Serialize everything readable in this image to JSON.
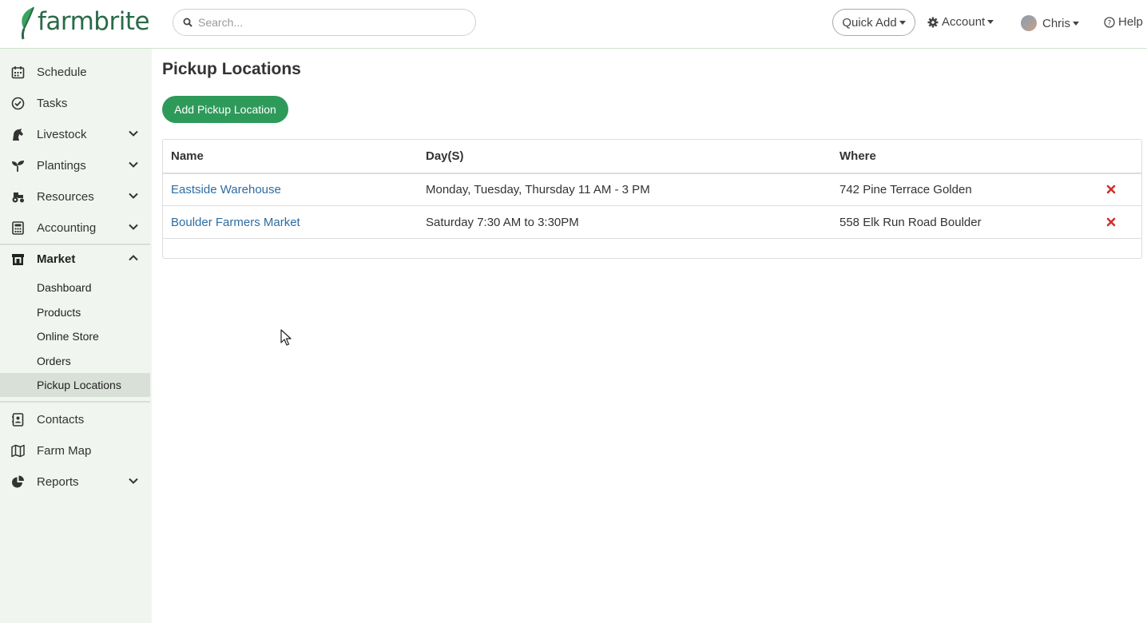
{
  "brand": {
    "name": "farmbrite",
    "color": "#2a6a48"
  },
  "search": {
    "placeholder": "Search..."
  },
  "header": {
    "quick_add": "Quick Add",
    "account": "Account",
    "user": "Chris",
    "help": "Help"
  },
  "sidebar": {
    "items": [
      {
        "label": "Schedule",
        "icon": "calendar-icon"
      },
      {
        "label": "Tasks",
        "icon": "check-circle-icon"
      },
      {
        "label": "Livestock",
        "icon": "horse-icon"
      },
      {
        "label": "Plantings",
        "icon": "seedling-icon"
      },
      {
        "label": "Resources",
        "icon": "tractor-icon"
      },
      {
        "label": "Accounting",
        "icon": "calculator-icon"
      },
      {
        "label": "Market",
        "icon": "store-icon"
      },
      {
        "label": "Contacts",
        "icon": "address-book-icon"
      },
      {
        "label": "Farm Map",
        "icon": "map-icon"
      },
      {
        "label": "Reports",
        "icon": "pie-chart-icon"
      }
    ],
    "market_sub": [
      {
        "label": "Dashboard"
      },
      {
        "label": "Products"
      },
      {
        "label": "Online Store"
      },
      {
        "label": "Orders"
      },
      {
        "label": "Pickup Locations",
        "active": true
      }
    ]
  },
  "main": {
    "title": "Pickup Locations",
    "add_button": "Add Pickup Location",
    "columns": [
      "Name",
      "Day(S)",
      "Where"
    ],
    "rows": [
      {
        "name": "Eastside Warehouse",
        "days": "Monday, Tuesday, Thursday 11 AM - 3 PM",
        "where": "742 Pine Terrace Golden"
      },
      {
        "name": "Boulder Farmers Market",
        "days": "Saturday 7:30 AM to 3:30PM",
        "where": "558 Elk Run Road Boulder"
      }
    ]
  },
  "colors": {
    "accent": "#2e9a5a",
    "link": "#2d6ca2",
    "delete": "#d0312d",
    "sidebar_bg": "#f0f6ef"
  }
}
